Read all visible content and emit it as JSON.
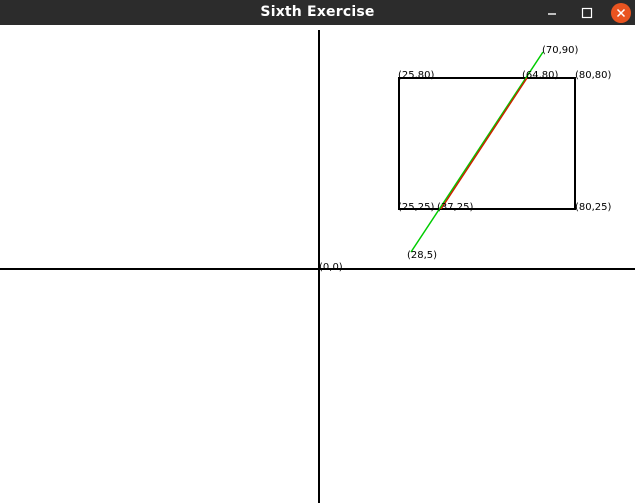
{
  "window": {
    "title": "Sixth Exercise",
    "close_color": "#e95420",
    "titlebar_color": "#2c2c2c"
  },
  "controls": {
    "minimize_icon": "minimize-icon",
    "maximize_icon": "maximize-icon",
    "close_icon": "close-icon"
  },
  "canvas": {
    "origin_label": "(0,0)",
    "rectangle": {
      "top_left_label": "(25,80)",
      "top_right_label": "(80,80)",
      "bottom_left_label": "(25,25)",
      "bottom_right_label": "(80,25)"
    },
    "line": {
      "start_label": "(28,5)",
      "end_label": "(70,90)",
      "color": "#00cc00"
    },
    "clipped_line": {
      "start_label": "(37,25)",
      "end_label": "(64,80)",
      "color": "#cc2200"
    }
  }
}
